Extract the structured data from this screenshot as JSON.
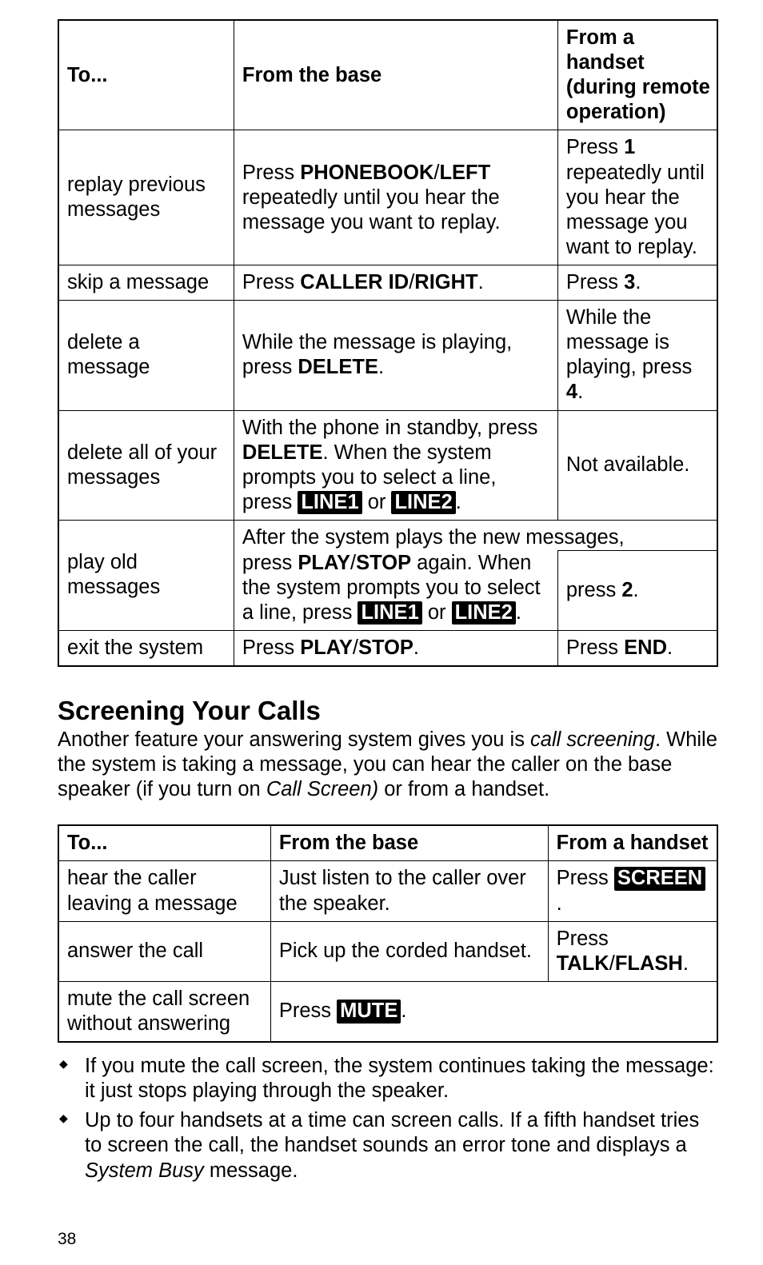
{
  "table1": {
    "header": {
      "to": "To...",
      "from_base": "From the base",
      "from_handset": "From a handset (during remote operation)"
    },
    "rows": {
      "replay_previous": {
        "to": "replay previous messages",
        "base_prefix": "Press ",
        "base_bold1": "PHONEBOOK",
        "base_mid1": "/",
        "base_bold2": "LEFT",
        "base_suffix": " repeatedly until you hear the message you want to replay.",
        "hs_prefix": "Press ",
        "hs_bold": "1",
        "hs_suffix": " repeatedly until you hear the message you want to replay."
      },
      "skip": {
        "to": "skip a message",
        "base_prefix": "Press ",
        "base_bold1": "CALLER ID",
        "base_mid1": "/",
        "base_bold2": "RIGHT",
        "base_period": ".",
        "hs_prefix": "Press ",
        "hs_bold": "3",
        "hs_period": "."
      },
      "delete": {
        "to": "delete a message",
        "base_prefix": "While the message is playing, press ",
        "base_bold": "DELETE",
        "base_period": ".",
        "hs_prefix": "While the message is playing, press ",
        "hs_bold": "4",
        "hs_period": "."
      },
      "delete_all": {
        "to": "delete all of your messages",
        "base_prefix": "With the phone in standby, press ",
        "base_bold1": "DELETE",
        "base_mid1": ". When the system prompts you to select a line, press ",
        "base_inv1": "LINE1",
        "base_mid2": " or ",
        "base_inv2": "LINE2",
        "base_period": ".",
        "hs": "Not available."
      },
      "play_old": {
        "to": "play old messages",
        "base_top": "After the system plays the new messages,",
        "base_prefix": "press ",
        "base_bold1": "PLAY",
        "base_mid1": "/",
        "base_bold2": "STOP",
        "base_mid2": " again. When the system prompts you to select a line, press ",
        "base_inv1": "LINE1",
        "base_mid3": " or ",
        "base_inv2": "LINE2",
        "base_period": ".",
        "hs_prefix": "press ",
        "hs_bold": "2",
        "hs_period": "."
      },
      "exit": {
        "to": "exit the system",
        "base_prefix": "Press ",
        "base_bold1": "PLAY",
        "base_mid1": "/",
        "base_bold2": "STOP",
        "base_period": ".",
        "hs_prefix": "Press ",
        "hs_bold": "END",
        "hs_period": "."
      }
    }
  },
  "section": {
    "heading": "Screening Your Calls",
    "para_pre": "Another feature your answering system gives you is ",
    "para_it1": "call screening",
    "para_mid": ". While the system is taking a message, you can hear the caller on the base speaker (if you turn on ",
    "para_it2": "Call Screen)",
    "para_suf": " or from a handset."
  },
  "table2": {
    "header": {
      "to": "To...",
      "from_base": "From the base",
      "from_handset": "From a handset"
    },
    "rows": {
      "hear": {
        "to": "hear the caller leaving a message",
        "base": "Just listen to the caller over the speaker.",
        "hs_prefix": "Press ",
        "hs_inv": "SCREEN",
        "hs_period": "."
      },
      "answer": {
        "to": "answer the call",
        "base": "Pick up the corded handset.",
        "hs_prefix": "Press ",
        "hs_bold1": "TALK",
        "hs_mid": "/",
        "hs_bold2": "FLASH",
        "hs_period": "."
      },
      "mute": {
        "to": "mute the call screen without answering",
        "base_prefix": "Press ",
        "base_inv": "MUTE",
        "base_period": "."
      }
    }
  },
  "bullets": {
    "b1": "If you mute the call screen, the system continues taking the message: it just stops playing through the speaker.",
    "b2_pre": "Up to four handsets at a time can screen calls. If a fifth handset tries to screen the call, the handset sounds an error tone and displays a ",
    "b2_it": "System Busy",
    "b2_suf": " message."
  },
  "page_number": "38"
}
